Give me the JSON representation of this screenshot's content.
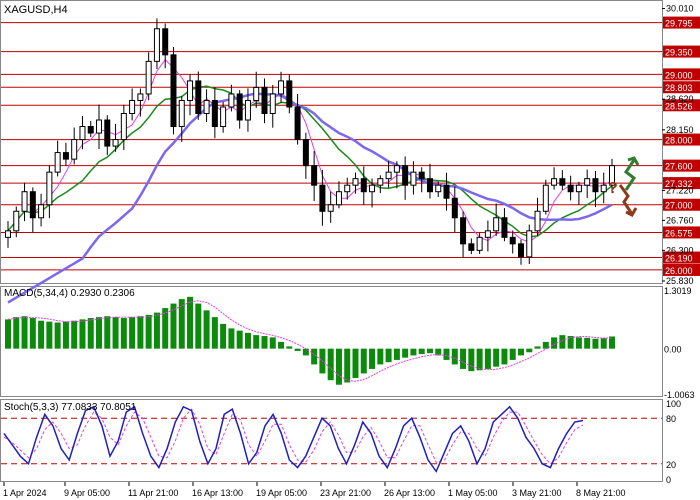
{
  "chart_data": [
    {
      "type": "candlestick",
      "title": "XAGUSD,H4",
      "ylim": [
        25.83,
        30.08
      ],
      "y_ticks": [
        "30.010",
        "29.795",
        "29.350",
        "29.000",
        "28.803",
        "28.526",
        "28.150",
        "28.000",
        "27.600",
        "27.332",
        "27.220",
        "27.000",
        "26.760",
        "26.575",
        "26.300",
        "26.190",
        "26.000",
        "25.830"
      ],
      "level_lines": [
        {
          "value": 29.795,
          "label": "29.795"
        },
        {
          "value": 29.35,
          "label": "29.350"
        },
        {
          "value": 29.0,
          "label": "29.000"
        },
        {
          "value": 28.803,
          "label": "28.803"
        },
        {
          "value": 28.526,
          "label": "28.526"
        },
        {
          "value": 28.0,
          "label": "28.000"
        },
        {
          "value": 27.6,
          "label": "27.600"
        },
        {
          "value": 27.332,
          "label": "27.332"
        },
        {
          "value": 27.0,
          "label": "27.000"
        },
        {
          "value": 26.575,
          "label": "26.575"
        },
        {
          "value": 26.19,
          "label": "26.190"
        },
        {
          "value": 26.0,
          "label": "26.000"
        }
      ],
      "plain_ticks": [
        {
          "value": 30.01,
          "label": "30.010"
        },
        {
          "value": 28.62,
          "label": "28.620"
        },
        {
          "value": 28.15,
          "label": "28.150"
        },
        {
          "value": 27.22,
          "label": "27.220"
        },
        {
          "value": 26.76,
          "label": "26.760"
        },
        {
          "value": 26.3,
          "label": "26.300"
        },
        {
          "value": 25.83,
          "label": "25.830"
        }
      ],
      "x_labels": [
        "1 Apr 2024",
        "9 Apr 05:00",
        "11 Apr 21:00",
        "16 Apr 13:00",
        "19 Apr 05:00",
        "23 Apr 21:00",
        "26 Apr 13:00",
        "1 May 05:00",
        "3 May 21:00",
        "8 May 21:00"
      ],
      "close_path": [
        26.6,
        26.9,
        27.2,
        26.8,
        27.0,
        27.5,
        27.8,
        27.7,
        28.0,
        28.2,
        28.1,
        28.3,
        27.9,
        28.0,
        28.4,
        28.6,
        28.7,
        29.2,
        29.7,
        29.3,
        28.2,
        28.6,
        28.9,
        28.4,
        28.6,
        28.2,
        28.5,
        28.7,
        28.3,
        28.6,
        28.8,
        28.4,
        28.7,
        28.9,
        28.5,
        28.0,
        27.6,
        27.3,
        26.9,
        27.0,
        27.2,
        27.3,
        27.4,
        27.2,
        27.3,
        27.4,
        27.5,
        27.6,
        27.3,
        27.5,
        27.4,
        27.2,
        27.3,
        27.1,
        26.8,
        26.4,
        26.3,
        26.5,
        26.6,
        26.8,
        26.5,
        26.4,
        26.2,
        26.6,
        26.9,
        27.3,
        27.4,
        27.3,
        27.2,
        27.3,
        27.4,
        27.2,
        27.3,
        27.6
      ],
      "ma_colors": {
        "fast": "#e040e0",
        "mid": "#1a8a1a",
        "slow": "#7b68ee"
      },
      "candle_up_color": "#000000",
      "candle_down_color": "#000000",
      "level_color": "#c00000",
      "arrow_up_color": "#2e7d32",
      "arrow_down_color": "#8b3a1a",
      "question_mark": "?"
    },
    {
      "type": "bar",
      "label": "MACD(5,34,4) 0.2930 0.2306",
      "ylim": [
        -1.0063,
        1.3019
      ],
      "y_ticks": [
        "1.3019",
        "0.00",
        "-1.0063"
      ],
      "histogram": [
        0.65,
        0.7,
        0.72,
        0.68,
        0.62,
        0.6,
        0.58,
        0.6,
        0.62,
        0.65,
        0.68,
        0.7,
        0.72,
        0.7,
        0.68,
        0.7,
        0.72,
        0.75,
        0.8,
        0.9,
        1.0,
        1.1,
        1.15,
        1.0,
        0.85,
        0.7,
        0.55,
        0.45,
        0.4,
        0.35,
        0.3,
        0.28,
        0.25,
        0.15,
        0.05,
        -0.05,
        -0.15,
        -0.35,
        -0.55,
        -0.7,
        -0.8,
        -0.75,
        -0.65,
        -0.55,
        -0.45,
        -0.35,
        -0.3,
        -0.25,
        -0.2,
        -0.15,
        -0.12,
        -0.1,
        -0.15,
        -0.25,
        -0.35,
        -0.45,
        -0.5,
        -0.48,
        -0.45,
        -0.4,
        -0.35,
        -0.25,
        -0.15,
        -0.08,
        0.05,
        0.15,
        0.25,
        0.3,
        0.28,
        0.25,
        0.24,
        0.22,
        0.23,
        0.27
      ],
      "signal_color": "#e040e0",
      "bar_color": "#0b8a0b"
    },
    {
      "type": "line",
      "label": "Stoch(5,3,3) 77.0833 70.8051",
      "ylim": [
        0,
        100
      ],
      "y_ticks": [
        "100",
        "80",
        "20",
        "0"
      ],
      "levels": [
        80,
        20
      ],
      "main": [
        60,
        45,
        30,
        20,
        55,
        85,
        70,
        40,
        25,
        60,
        90,
        95,
        70,
        30,
        50,
        88,
        95,
        60,
        30,
        15,
        40,
        75,
        95,
        90,
        50,
        20,
        40,
        85,
        92,
        60,
        20,
        35,
        70,
        85,
        60,
        25,
        15,
        30,
        55,
        80,
        70,
        40,
        20,
        45,
        75,
        60,
        30,
        15,
        40,
        70,
        80,
        55,
        25,
        10,
        35,
        60,
        70,
        50,
        20,
        40,
        75,
        85,
        95,
        80,
        55,
        40,
        20,
        15,
        40,
        60,
        75,
        77
      ],
      "signal": [
        55,
        48,
        38,
        28,
        40,
        65,
        75,
        60,
        40,
        45,
        70,
        88,
        80,
        55,
        45,
        70,
        88,
        80,
        55,
        30,
        28,
        50,
        80,
        92,
        72,
        40,
        32,
        60,
        85,
        78,
        45,
        30,
        50,
        72,
        72,
        45,
        25,
        22,
        38,
        62,
        75,
        58,
        35,
        35,
        55,
        68,
        50,
        28,
        28,
        50,
        70,
        70,
        45,
        22,
        25,
        45,
        62,
        60,
        40,
        30,
        55,
        75,
        88,
        88,
        70,
        50,
        32,
        20,
        28,
        48,
        65,
        71
      ],
      "main_color": "#1f1fbf",
      "signal_color": "#e040e0",
      "level_color": "#c00000"
    }
  ]
}
